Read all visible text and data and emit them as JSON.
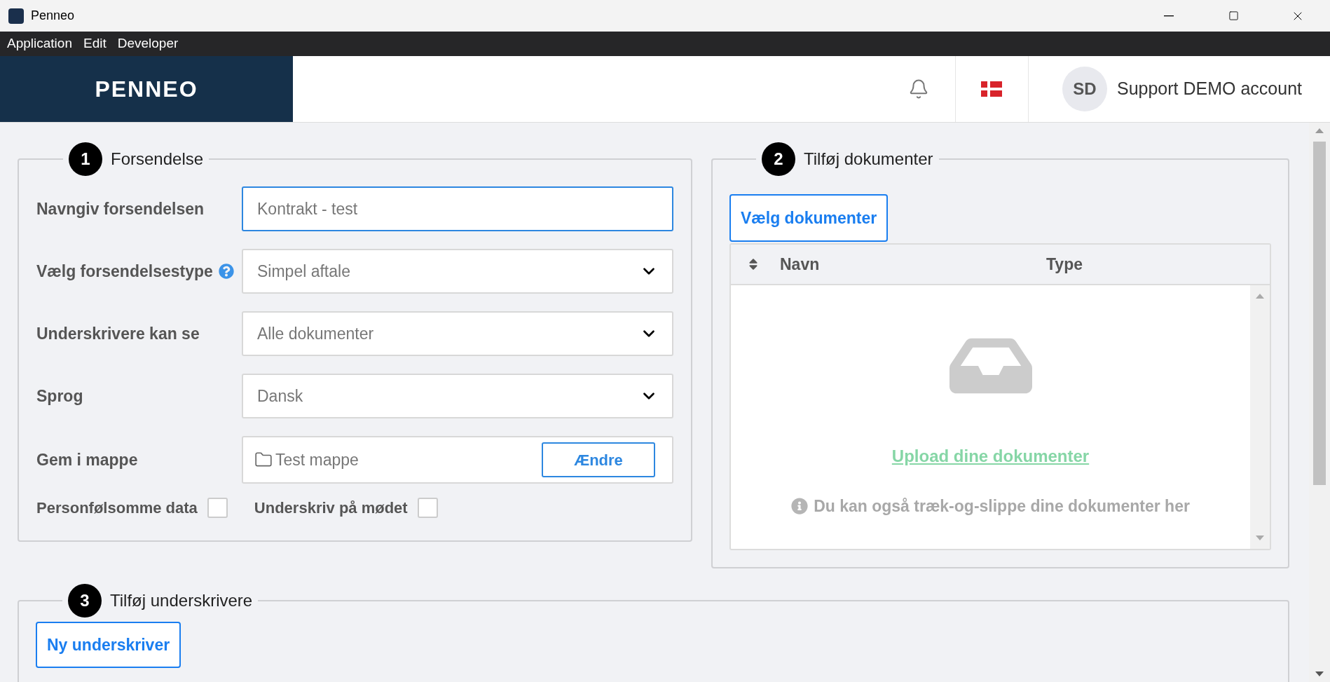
{
  "window": {
    "title": "Penneo"
  },
  "menu": [
    "Application",
    "Edit",
    "Developer"
  ],
  "header": {
    "logo": "PENNEO",
    "avatar_initials": "SD",
    "account_name": "Support DEMO account"
  },
  "section_1": {
    "number": "1",
    "title": "Forsendelse",
    "fields": [
      {
        "kind": "text",
        "label": "Navngiv forsendelsen",
        "value": "Kontrakt - test",
        "focused": true,
        "help": false
      },
      {
        "kind": "select",
        "label": "Vælg forsendelsestype",
        "value": "Simpel aftale",
        "focused": false,
        "help": true
      },
      {
        "kind": "select",
        "label": "Underskrivere kan se",
        "value": "Alle dokumenter",
        "focused": false,
        "help": false
      },
      {
        "kind": "select",
        "label": "Sprog",
        "value": "Dansk",
        "focused": false,
        "help": false
      },
      {
        "kind": "folder",
        "label": "Gem i mappe",
        "value": "Test mappe",
        "button": "Ændre",
        "focused": false,
        "help": false
      }
    ],
    "checkboxes": [
      {
        "label": "Personfølsomme data",
        "checked": false
      },
      {
        "label": "Underskriv på mødet",
        "checked": false
      }
    ]
  },
  "section_2": {
    "number": "2",
    "title": "Tilføj dokumenter",
    "button": "Vælg dokumenter",
    "table": {
      "columns": [
        "Navn",
        "Type"
      ],
      "empty_link": "Upload dine dokumenter",
      "empty_hint": "Du kan også træk-og-slippe dine dokumenter her"
    }
  },
  "section_3": {
    "number": "3",
    "title": "Tilføj underskrivere",
    "button": "Ny underskriver"
  }
}
